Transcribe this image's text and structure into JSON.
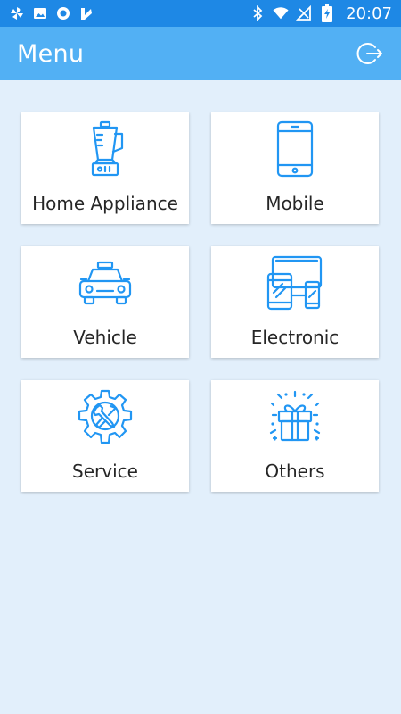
{
  "status_bar": {
    "time": "20:07",
    "left_icons": [
      "pinwheel-icon",
      "image-icon",
      "circle-app-icon",
      "checkmark-app-icon"
    ],
    "right_icons": [
      "bluetooth-icon",
      "wifi-icon",
      "signal-off-icon",
      "battery-charging-icon"
    ]
  },
  "app_bar": {
    "title": "Menu",
    "logout_icon": "logout-icon"
  },
  "menu": {
    "items": [
      {
        "label": "Home Appliance",
        "icon": "blender-icon"
      },
      {
        "label": "Mobile",
        "icon": "mobile-phone-icon"
      },
      {
        "label": "Vehicle",
        "icon": "taxi-icon"
      },
      {
        "label": "Electronic",
        "icon": "devices-icon"
      },
      {
        "label": "Service",
        "icon": "gear-wrench-icon"
      },
      {
        "label": "Others",
        "icon": "gift-icon"
      }
    ]
  },
  "colors": {
    "status_bar": "#1e88e5",
    "app_bar": "#52b0f4",
    "background": "#e2effb",
    "icon_accent": "#2196f3",
    "card": "#ffffff",
    "label_text": "#262626"
  }
}
